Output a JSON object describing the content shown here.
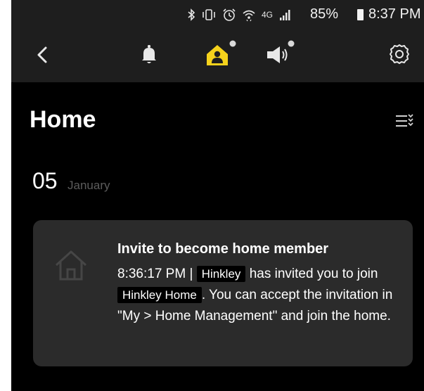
{
  "status_bar": {
    "network_label": "4G",
    "battery_percent": "85%",
    "time": "8:37 PM",
    "icons": [
      "bluetooth-icon",
      "vibrate-icon",
      "alarm-icon",
      "wifi-icon",
      "network-4g-icon",
      "signal-icon",
      "battery-icon"
    ]
  },
  "toolbar": {
    "icons": [
      "back-arrow-icon",
      "bell-icon",
      "home-person-icon",
      "speaker-icon",
      "settings-gear-icon"
    ],
    "accent_color": "#f5d21c",
    "badge_color": "#d9d9d9"
  },
  "page": {
    "title": "Home",
    "list_icon": "list-filter-icon"
  },
  "date": {
    "day": "05",
    "month": "January"
  },
  "notifications": [
    {
      "icon": "home-outline-icon",
      "title": "Invite to become home member",
      "time": "8:36:17 PM | ",
      "inviter": "Hinkley",
      "text_after_inviter": " has invited you to join ",
      "home_name": "Hinkley Home",
      "text_after_home": ". You can accept the invitation in \"My > Home Management\" and join the home."
    }
  ]
}
